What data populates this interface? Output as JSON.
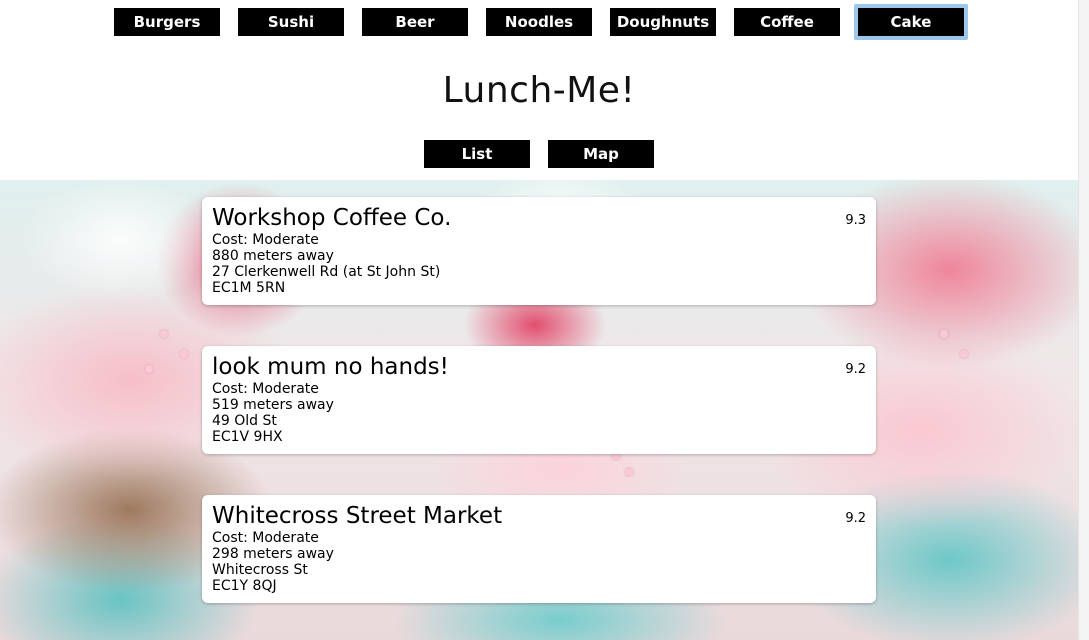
{
  "categories": [
    "Burgers",
    "Sushi",
    "Beer",
    "Noodles",
    "Doughnuts",
    "Coffee",
    "Cake"
  ],
  "active_category": "Cake",
  "title": "Lunch-Me!",
  "views": {
    "list_label": "List",
    "map_label": "Map"
  },
  "venues": [
    {
      "name": "Workshop Coffee Co.",
      "rating": "9.3",
      "cost": "Cost: Moderate",
      "distance": "880 meters away",
      "address": "27 Clerkenwell Rd (at St John St)",
      "postcode": "EC1M 5RN"
    },
    {
      "name": "look mum no hands!",
      "rating": "9.2",
      "cost": "Cost: Moderate",
      "distance": "519 meters away",
      "address": "49 Old St",
      "postcode": "EC1V 9HX"
    },
    {
      "name": "Whitecross Street Market",
      "rating": "9.2",
      "cost": "Cost: Moderate",
      "distance": "298 meters away",
      "address": "Whitecross St",
      "postcode": "EC1Y 8QJ"
    }
  ],
  "colors": {
    "button_bg": "#000000",
    "button_text": "#ffffff",
    "active_outline": "#9cc7ec",
    "card_bg": "#ffffff"
  }
}
